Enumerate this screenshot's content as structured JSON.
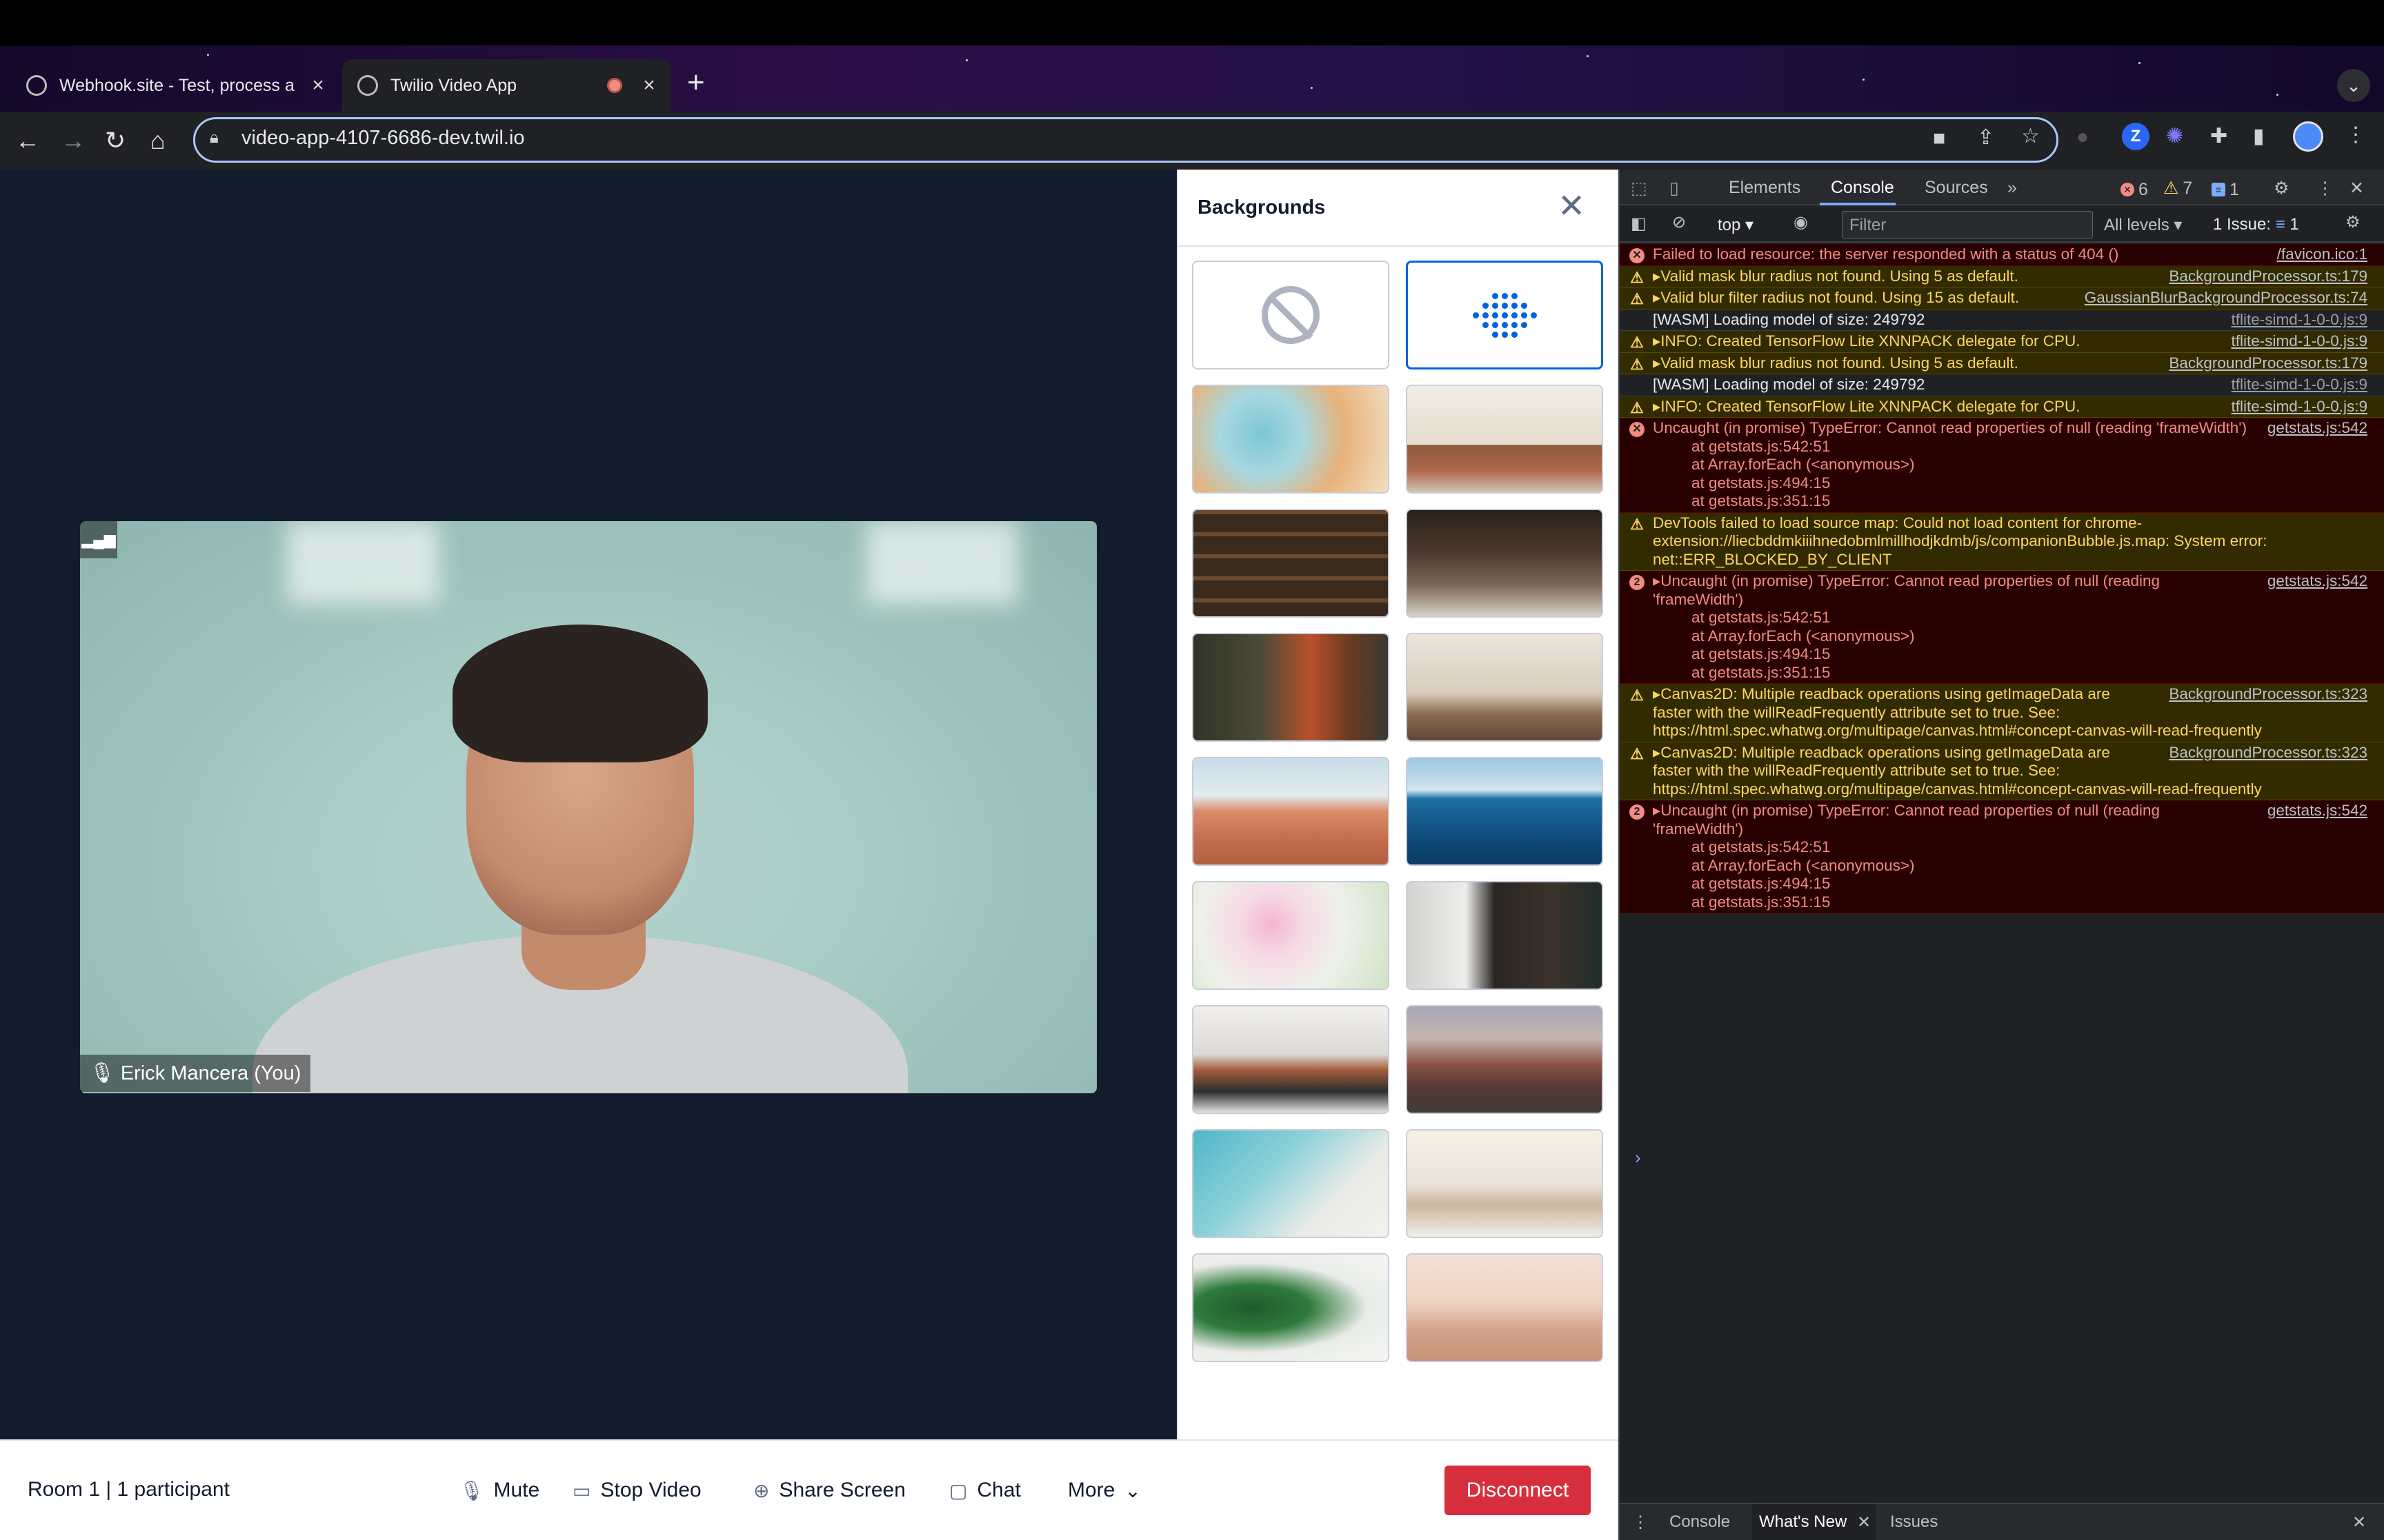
{
  "browser": {
    "tabs": [
      {
        "title": "Webhook.site - Test, process a",
        "active": false
      },
      {
        "title": "Twilio Video App",
        "active": true
      }
    ],
    "url": "video-app-4107-6686-dev.twil.io"
  },
  "video": {
    "participant_name": "Erick Mancera (You)"
  },
  "backgrounds": {
    "title": "Backgrounds",
    "thumbnails": [
      {
        "kind": "none",
        "selected": false
      },
      {
        "kind": "blur",
        "selected": true
      },
      {
        "kind": "image",
        "name": "abstract-smoke"
      },
      {
        "kind": "image",
        "name": "living-room"
      },
      {
        "kind": "image",
        "name": "bookshelf"
      },
      {
        "kind": "image",
        "name": "coffee-shop"
      },
      {
        "kind": "image",
        "name": "orange-lounge"
      },
      {
        "kind": "image",
        "name": "boho-room"
      },
      {
        "kind": "image",
        "name": "desert"
      },
      {
        "kind": "image",
        "name": "ocean"
      },
      {
        "kind": "image",
        "name": "flowers"
      },
      {
        "kind": "image",
        "name": "modern-kitchen"
      },
      {
        "kind": "image",
        "name": "modern-living"
      },
      {
        "kind": "image",
        "name": "mountains"
      },
      {
        "kind": "image",
        "name": "beach"
      },
      {
        "kind": "image",
        "name": "dining-room"
      },
      {
        "kind": "image",
        "name": "monstera-leaves"
      },
      {
        "kind": "image",
        "name": "golden-gate"
      }
    ]
  },
  "footer": {
    "room_info": "Room 1 | 1 participant",
    "mute": "Mute",
    "stop_video": "Stop Video",
    "share_screen": "Share Screen",
    "chat": "Chat",
    "more": "More",
    "disconnect": "Disconnect"
  },
  "devtools": {
    "tabs": [
      "Elements",
      "Console",
      "Sources"
    ],
    "active_tab": "Console",
    "error_count": "6",
    "warning_count": "7",
    "info_count": "1",
    "context": "top",
    "filter_placeholder": "Filter",
    "levels": "All levels",
    "issues_label": "1 Issue:",
    "issues_count": "1",
    "messages": [
      {
        "level": "err",
        "text": "Failed to load resource: the server responded with a status of 404 ()",
        "source": "/favicon.ico:1"
      },
      {
        "level": "warn",
        "text": "▸Valid mask blur radius not found. Using 5 as default.",
        "source": "BackgroundProcessor.ts:179"
      },
      {
        "level": "warn",
        "text": "▸Valid blur filter radius not found. Using 15 as default.",
        "source": "GaussianBlurBackgroundProcessor.ts:74"
      },
      {
        "level": "info",
        "text": "[WASM] Loading model of size: 249792",
        "source": "tflite-simd-1-0-0.js:9"
      },
      {
        "level": "warn",
        "text": "▸INFO: Created TensorFlow Lite XNNPACK delegate for CPU.",
        "source": "tflite-simd-1-0-0.js:9"
      },
      {
        "level": "warn",
        "text": "▸Valid mask blur radius not found. Using 5 as default.",
        "source": "BackgroundProcessor.ts:179"
      },
      {
        "level": "info",
        "text": "[WASM] Loading model of size: 249792",
        "source": "tflite-simd-1-0-0.js:9"
      },
      {
        "level": "warn",
        "text": "▸INFO: Created TensorFlow Lite XNNPACK delegate for CPU.",
        "source": "tflite-simd-1-0-0.js:9"
      },
      {
        "level": "err",
        "text": "Uncaught (in promise) TypeError: Cannot read properties of null (reading 'frameWidth')",
        "source": "getstats.js:542",
        "stack": [
          "at getstats.js:542:51",
          "at Array.forEach (<anonymous>)",
          "at getstats.js:494:15",
          "at getstats.js:351:15"
        ]
      },
      {
        "level": "warn",
        "text": "DevTools failed to load source map: Could not load content for chrome-extension://liecbddmkiiihnedobmlmillhodjkdmb/js/companionBubble.js.map: System error: net::ERR_BLOCKED_BY_CLIENT",
        "source": ""
      },
      {
        "level": "err",
        "count": "2",
        "text": "▸Uncaught (in promise) TypeError: Cannot read properties of null (reading 'frameWidth')",
        "source": "getstats.js:542",
        "stack": [
          "at getstats.js:542:51",
          "at Array.forEach (<anonymous>)",
          "at getstats.js:494:15",
          "at getstats.js:351:15"
        ]
      },
      {
        "level": "warn",
        "text": "▸Canvas2D: Multiple readback operations using getImageData are faster with the willReadFrequently attribute set to true. See: https://html.spec.whatwg.org/multipage/canvas.html#concept-canvas-will-read-frequently",
        "source": "BackgroundProcessor.ts:323"
      },
      {
        "level": "warn",
        "text": "▸Canvas2D: Multiple readback operations using getImageData are faster with the willReadFrequently attribute set to true. See: https://html.spec.whatwg.org/multipage/canvas.html#concept-canvas-will-read-frequently",
        "source": "BackgroundProcessor.ts:323"
      },
      {
        "level": "err",
        "count": "2",
        "text": "▸Uncaught (in promise) TypeError: Cannot read properties of null (reading 'frameWidth')",
        "source": "getstats.js:542",
        "stack": [
          "at getstats.js:542:51",
          "at Array.forEach (<anonymous>)",
          "at getstats.js:494:15",
          "at getstats.js:351:15"
        ]
      }
    ],
    "drawer_tabs": [
      "Console",
      "What's New",
      "Issues"
    ],
    "drawer_active": "What's New"
  },
  "colors": {
    "disconnect": "#d72e3d",
    "selection": "#0263e0",
    "stage_bg": "#121c2d"
  }
}
